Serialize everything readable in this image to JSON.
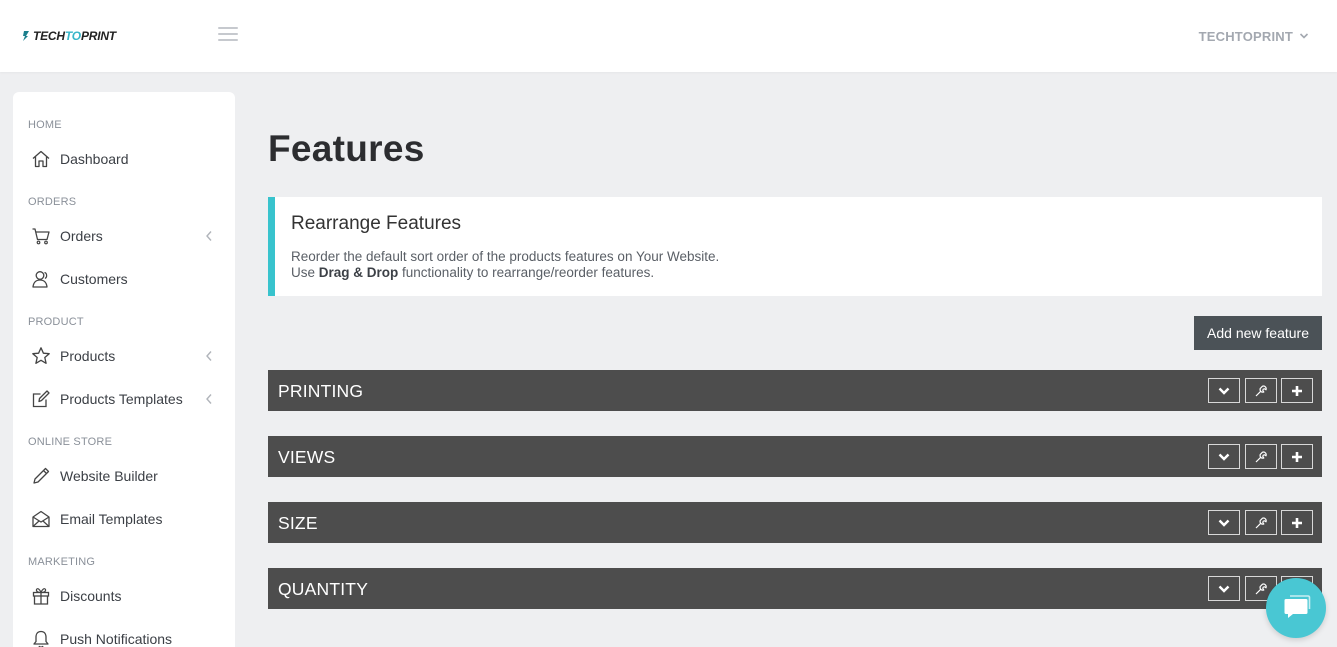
{
  "header": {
    "logo": {
      "part1": "TECH",
      "part2": "TO",
      "part3": "PRINT"
    },
    "user_label": "TECHTOPRINT"
  },
  "sidebar": {
    "sections": [
      {
        "label": "HOME"
      },
      {
        "label": "ORDERS"
      },
      {
        "label": "PRODUCT"
      },
      {
        "label": "ONLINE STORE"
      },
      {
        "label": "MARKETING"
      }
    ],
    "items": [
      {
        "label": "Dashboard",
        "icon": "home-icon"
      },
      {
        "label": "Orders",
        "icon": "cart-icon"
      },
      {
        "label": "Customers",
        "icon": "customers-icon"
      },
      {
        "label": "Products",
        "icon": "star-icon"
      },
      {
        "label": "Products Templates",
        "icon": "edit-icon"
      },
      {
        "label": "Website Builder",
        "icon": "pencil-icon"
      },
      {
        "label": "Email Templates",
        "icon": "envelope-icon"
      },
      {
        "label": "Discounts",
        "icon": "gift-icon"
      },
      {
        "label": "Push Notifications",
        "icon": "bell-icon"
      }
    ]
  },
  "main": {
    "title": "Features",
    "info": {
      "heading": "Rearrange Features",
      "line1": "Reorder the default sort order of the products features on Your Website.",
      "line2_prefix": "Use ",
      "line2_bold": "Drag & Drop",
      "line2_suffix": " functionality to rearrange/reorder features."
    },
    "add_button": "Add new feature",
    "features": [
      {
        "name": "PRINTING"
      },
      {
        "name": "VIEWS"
      },
      {
        "name": "SIZE"
      },
      {
        "name": "QUANTITY"
      }
    ]
  },
  "colors": {
    "accent": "#38c3cd",
    "feature_bar": "#4d4d4d",
    "button": "#4b5257",
    "chat": "#49c7d3"
  }
}
